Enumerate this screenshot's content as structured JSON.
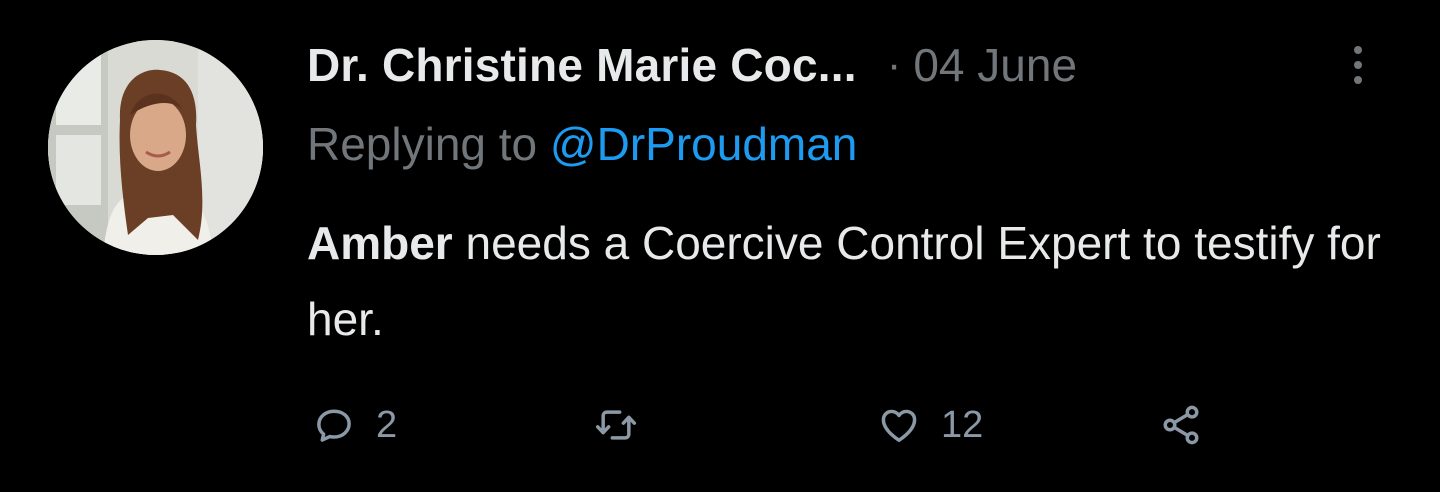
{
  "tweet": {
    "author_name": "Dr. Christine Marie Coc...",
    "separator": "·",
    "date": "04 June",
    "replying_prefix": "Replying to",
    "replying_handle": "@DrProudman",
    "body_bold": "Amber",
    "body_text": " needs a Coercive Control Expert to testify for her."
  },
  "actions": {
    "reply_count": "2",
    "retweet_count": "",
    "like_count": "12"
  },
  "icons": {
    "reply": "reply-icon",
    "retweet": "retweet-icon",
    "like": "heart-icon",
    "share": "share-icon",
    "more": "more-vertical-icon"
  },
  "colors": {
    "background": "#000000",
    "text": "#e7e9ea",
    "muted": "#71767b",
    "link": "#1d9bf0",
    "action_icon": "#8b98a5"
  }
}
